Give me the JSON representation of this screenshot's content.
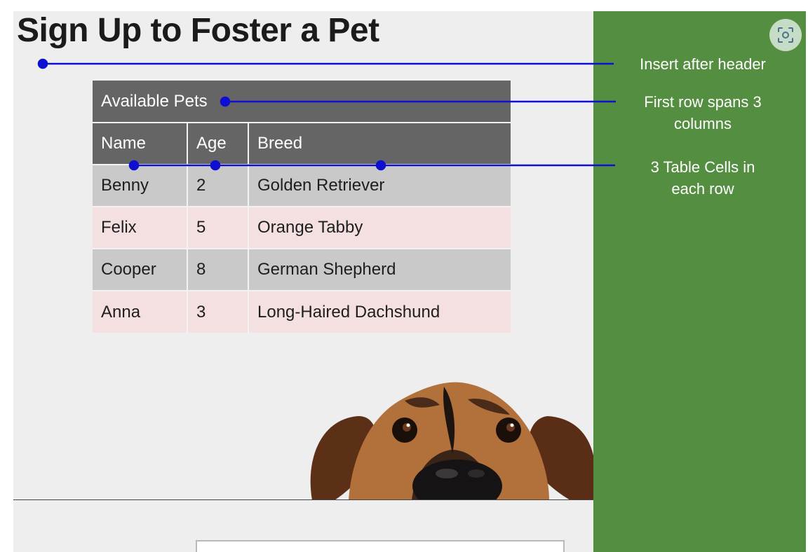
{
  "page": {
    "title": "Sign Up to Foster a Pet"
  },
  "table": {
    "caption": "Available Pets",
    "headers": [
      "Name",
      "Age",
      "Breed"
    ],
    "rows": [
      [
        "Benny",
        "2",
        "Golden Retriever"
      ],
      [
        "Felix",
        "5",
        "Orange Tabby"
      ],
      [
        "Cooper",
        "8",
        "German Shepherd"
      ],
      [
        "Anna",
        "3",
        "Long-Haired Dachshund"
      ]
    ]
  },
  "annotations": {
    "note1": "Insert after header",
    "note2_line1": "First row spans 3",
    "note2_line2": "columns",
    "note3_line1": "3 Table Cells in",
    "note3_line2": "each row"
  },
  "colors": {
    "panel": "#548f41",
    "arrow": "#0f0fd2",
    "header_bg": "#656565",
    "row_grey": "#c9c9c9",
    "row_pink": "#f4e0e1"
  },
  "icons": {
    "corner_button": "screenshot-icon",
    "illustration": "dog-illustration"
  }
}
